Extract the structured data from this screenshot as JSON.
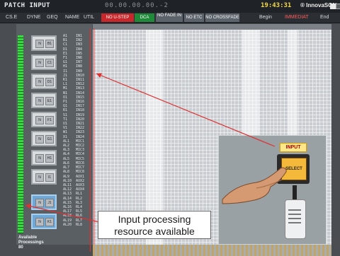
{
  "titlebar": {
    "app_title": "PATCH INPUT",
    "timecode": "00.00.00.00.-2",
    "clock": "19:43:31",
    "brand": "® InnovaSON"
  },
  "menu": {
    "items": [
      "CS.E",
      "DYNE",
      "GEQ",
      "NAME",
      "UTIL"
    ],
    "buttons": [
      {
        "label": "NO U-STEP",
        "color": "#c8282b"
      },
      {
        "label": "DCA",
        "color": "#1f8a3a"
      },
      {
        "label": "NO FADE IN",
        "color": "#5d636a"
      },
      {
        "label": "NO ETC",
        "color": "#5d636a"
      },
      {
        "label": "NO CROSSFADE",
        "color": "#5d636a"
      }
    ],
    "begin": "Begin",
    "center": "IMMEDIAT",
    "end": "End"
  },
  "channels": [
    {
      "tag": "B1"
    },
    {
      "tag": "C1"
    },
    {
      "tag": "D1"
    },
    {
      "tag": "E1"
    },
    {
      "tag": "F1"
    },
    {
      "tag": "G1"
    },
    {
      "tag": "H1"
    },
    {
      "tag": "I1"
    },
    {
      "tag": "J1"
    },
    {
      "tag": "K1"
    }
  ],
  "column_a": "A1\nB1\nC1\nD1\nE1\nF1\nG1\nH1\nI1\nJ1\nK1\nL1\nM1\nN1\nO1\nP1\nQ1\nR1\nS1\nT1\nU1\nV1\nW1\nX1\nAL1\nAL2\nAL3\nAL4\nAL5\nAL6\nAL7\nAL8\nAL9\nAL10\nAL11\nAL12\nAL13\nAL14\nAL15\nAL16\nAL17\nAL18\nAL19\nAL20",
  "column_b": "IN1\nIN2\nIN3\nIN4\nIN5\nIN6\nIN7\nIN8\nIN9\nIN10\nIN11\nIN12\nIN13\nIN14\nIN15\nIN16\nIN17\nIN18\nIN19\nIN20\nIN21\nIN22\nIN23\nIN24\nMIC1\nMIC2\nMIC3\nMIC4\nMIC5\nMIC6\nMIC7\nMIC8\nAUX1\nAUX2\nAUX3\nAUX4\nRL1\nRL2\nRL3\nRL4\nRL5\nRL6\nRL7\nRL8",
  "available_label": "Available\nProcessings\n80",
  "photo": {
    "input_label": "INPUT",
    "button_text": "SELECT"
  },
  "callout": {
    "line1": "Input processing",
    "line2": "resource available"
  }
}
